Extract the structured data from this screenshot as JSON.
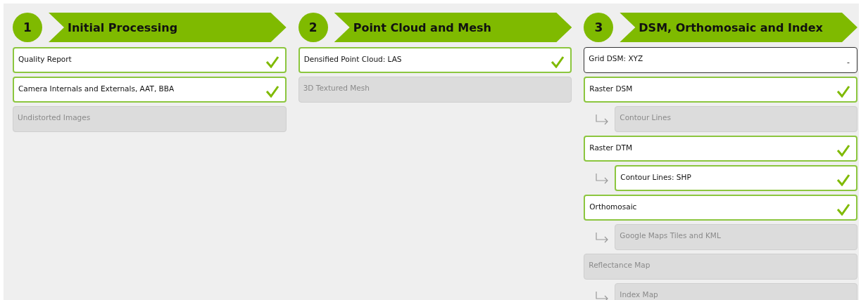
{
  "steps": [
    {
      "number": "1",
      "title": "Initial Processing",
      "items": [
        {
          "label": "Quality Report",
          "done": true,
          "disabled": false
        },
        {
          "label": "Camera Internals and Externals, AAT, BBA",
          "done": true,
          "disabled": false
        },
        {
          "label": "Undistorted Images",
          "done": false,
          "disabled": true
        }
      ]
    },
    {
      "number": "2",
      "title": "Point Cloud and Mesh",
      "items": [
        {
          "label": "Densified Point Cloud: LAS",
          "done": true,
          "disabled": false
        },
        {
          "label": "3D Textured Mesh",
          "done": false,
          "disabled": true
        }
      ]
    },
    {
      "number": "3",
      "title": "DSM, Orthomosaic and Index",
      "items": [
        {
          "label": "Grid DSM: XYZ",
          "done": false,
          "disabled": false,
          "indicator": "-"
        },
        {
          "label": "Raster DSM",
          "done": true,
          "disabled": false,
          "children": [
            {
              "label": "Contour Lines",
              "done": false,
              "disabled": true
            }
          ]
        },
        {
          "label": "Raster DTM",
          "done": true,
          "disabled": false,
          "children": [
            {
              "label": "Contour Lines: SHP",
              "done": true,
              "disabled": false
            }
          ]
        },
        {
          "label": "Orthomosaic",
          "done": true,
          "disabled": false,
          "children": [
            {
              "label": "Google Maps Tiles and KML",
              "done": false,
              "disabled": true
            }
          ]
        },
        {
          "label": "Reflectance Map",
          "done": false,
          "disabled": true,
          "children": [
            {
              "label": "Index Map",
              "done": false,
              "disabled": true
            }
          ]
        }
      ]
    }
  ]
}
